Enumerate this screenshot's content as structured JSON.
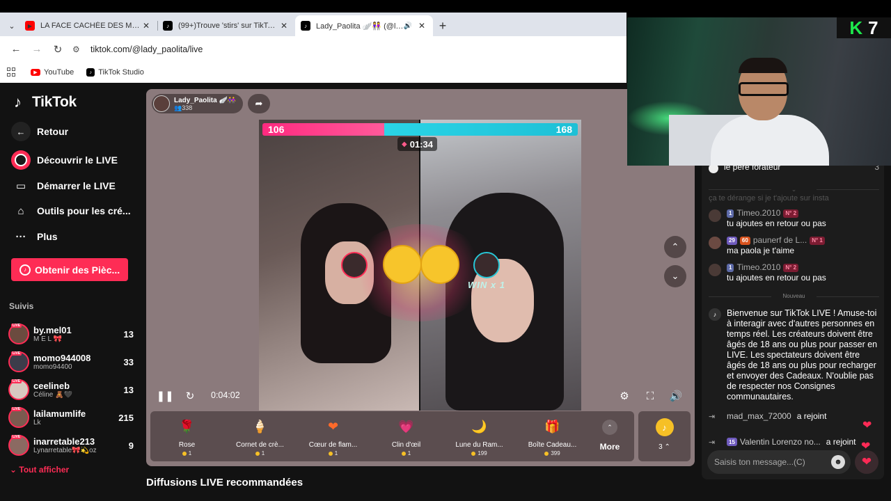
{
  "browser": {
    "tabs": [
      {
        "title": "LA FACE CACHÉE DES MILLIONN",
        "favicon": "youtube-icon",
        "active": false
      },
      {
        "title": "(99+)Trouve 'stirs' sur TikTok | R",
        "favicon": "tiktok-icon",
        "active": false
      },
      {
        "title": "Lady_Paolita 🪽👭 (@lady_",
        "favicon": "tiktok-icon",
        "active": true
      }
    ],
    "url": "tiktok.com/@lady_paolita/live",
    "bookmarks": [
      {
        "label": "YouTube",
        "favicon": "youtube-icon"
      },
      {
        "label": "TikTok Studio",
        "favicon": "tiktok-icon"
      }
    ]
  },
  "sidebar": {
    "logo": "TikTok",
    "back": "Retour",
    "nav": [
      {
        "label": "Découvrir le LIVE",
        "icon": "live-icon"
      },
      {
        "label": "Démarrer le LIVE",
        "icon": "camera-icon"
      },
      {
        "label": "Outils pour les cré...",
        "icon": "house-tools-icon"
      },
      {
        "label": "Plus",
        "icon": "more-dots-icon"
      }
    ],
    "coins_button": "Obtenir des Pièc...",
    "suivis_title": "Suivis",
    "following": [
      {
        "name": "by.mel01",
        "sub": "M E L 🎀",
        "count": "13"
      },
      {
        "name": "momo944008",
        "sub": "momo94400",
        "count": "33"
      },
      {
        "name": "ceelineb",
        "sub": "Céline 🧸🖤",
        "count": "13"
      },
      {
        "name": "lailamumlife",
        "sub": "Lk",
        "count": "215"
      },
      {
        "name": "inarretable213",
        "sub": "Lynarretable🎀💫oz",
        "count": "9"
      }
    ],
    "show_all": "Tout afficher"
  },
  "player": {
    "host_name": "Lady_Paolita 🪽👭",
    "viewers": "338",
    "score_left": "106",
    "score_right": "168",
    "score_left_fraction": 0.387,
    "battle_timer": "01:34",
    "win_label": "WIN x 1",
    "elapsed": "0:04:02",
    "gifts": [
      {
        "name": "Rose",
        "price": "1",
        "glyph": "🌹"
      },
      {
        "name": "Cornet de crè...",
        "price": "1",
        "glyph": "🍦"
      },
      {
        "name": "Cœur de flam...",
        "price": "1",
        "glyph": "❤"
      },
      {
        "name": "Clin d'œil",
        "price": "1",
        "glyph": "💗"
      },
      {
        "name": "Lune du Ram...",
        "price": "199",
        "glyph": "🌙"
      },
      {
        "name": "Boîte Cadeau...",
        "price": "399",
        "glyph": "🎁"
      }
    ],
    "more_label": "More",
    "coin_balance": "3"
  },
  "recommended_title": "Diffusions LIVE recommandées",
  "chat": {
    "top_partial": {
      "rank": "3",
      "user": "le père forateur",
      "count": "3"
    },
    "partial_line": "ça te dérange si je t'ajoute sur insta",
    "messages": [
      {
        "level": "1",
        "user": "Timeo.2010",
        "rank": "N° 2",
        "text": "tu ajoutes en retour ou pas"
      },
      {
        "level": "29",
        "fan": "60",
        "user": "paunerf de L...",
        "rank": "N° 1",
        "text": "ma paola je t'aime"
      },
      {
        "level": "1",
        "user": "Timeo.2010",
        "rank": "N° 2",
        "text": "tu ajoutes en retour ou pas"
      }
    ],
    "separator": "Nouveau",
    "system_message": "Bienvenue sur TikTok LIVE ! Amuse-toi à interagir avec d'autres personnes en temps réel. Les créateurs doivent être âgés de 18 ans ou plus pour passer en LIVE. Les spectateurs doivent être âgés de 18 ans ou plus pour recharger et envoyer des Cadeaux. N'oublie pas de respecter nos Consignes communautaires.",
    "joins": [
      {
        "user": "mad_max_72000",
        "action": "a rejoint"
      },
      {
        "level": "15",
        "user": "Valentin Lorenzo no...",
        "action": "a rejoint"
      }
    ],
    "input_placeholder": "Saisis ton message...(C)"
  },
  "overlay": {
    "channel_number": "7"
  }
}
